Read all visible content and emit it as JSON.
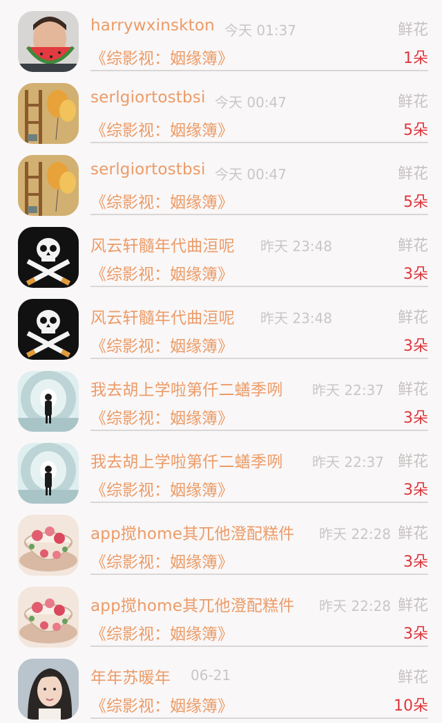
{
  "records": [
    {
      "user": "harrywxinskton",
      "time": "今天 01:37",
      "gift": "鲜花",
      "book": "《综影视：姻缘簿》",
      "count": "1朵",
      "avatar": "watermelon-man-avatar"
    },
    {
      "user": "serlgiortostbsi",
      "time": "今天 00:47",
      "gift": "鲜花",
      "book": "《综影视：姻缘簿》",
      "count": "5朵",
      "avatar": "balloon-ladder-avatar"
    },
    {
      "user": "serlgiortostbsi",
      "time": "今天 00:47",
      "gift": "鲜花",
      "book": "《综影视：姻缘簿》",
      "count": "5朵",
      "avatar": "balloon-ladder-avatar"
    },
    {
      "user": "风云轩髓年代曲洹呢",
      "time": "昨天 23:48",
      "gift": "鲜花",
      "book": "《综影视：姻缘簿》",
      "count": "3朵",
      "avatar": "skull-cigarettes-avatar"
    },
    {
      "user": "风云轩髓年代曲洹呢",
      "time": "昨天 23:48",
      "gift": "鲜花",
      "book": "《综影视：姻缘簿》",
      "count": "3朵",
      "avatar": "skull-cigarettes-avatar"
    },
    {
      "user": "我去胡上学啦第仟二蟮季咧",
      "time": "昨天 22:37",
      "gift": "鲜花",
      "book": "《综影视：姻缘簿》",
      "count": "3朵",
      "avatar": "tunnel-figure-avatar"
    },
    {
      "user": "我去胡上学啦第仟二蟮季咧",
      "time": "昨天 22:37",
      "gift": "鲜花",
      "book": "《综影视：姻缘簿》",
      "count": "3朵",
      "avatar": "tunnel-figure-avatar"
    },
    {
      "user": "app搅home其兀他澄配糕件",
      "time": "昨天 22:28",
      "gift": "鲜花",
      "book": "《综影视：姻缘簿》",
      "count": "3朵",
      "avatar": "teacup-roses-avatar"
    },
    {
      "user": "app搅home其兀他澄配糕件",
      "time": "昨天 22:28",
      "gift": "鲜花",
      "book": "《综影视：姻缘簿》",
      "count": "3朵",
      "avatar": "teacup-roses-avatar"
    },
    {
      "user": "年年苏暖年",
      "time": "06-21",
      "gift": "鲜花",
      "book": "《综影视：姻缘簿》",
      "count": "10朵",
      "avatar": "woman-portrait-avatar"
    }
  ],
  "colors": {
    "name": "#ec9b66",
    "book": "#ec9b66",
    "count": "#e0343a",
    "meta": "#c9c6c6",
    "background": "#f9f7f8"
  }
}
